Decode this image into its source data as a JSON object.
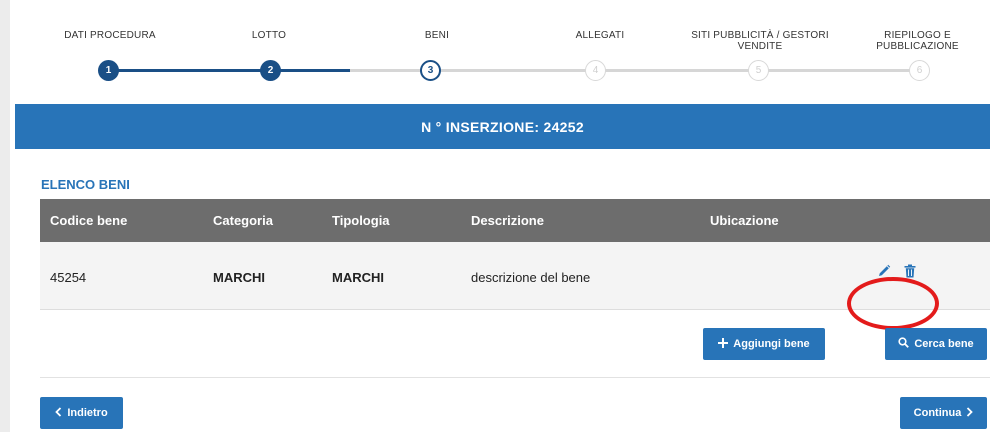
{
  "stepper": {
    "steps": [
      {
        "label_line1": "DATI PROCEDURA",
        "label_line2": "",
        "number": "1",
        "state": "done"
      },
      {
        "label_line1": "LOTTO",
        "label_line2": "",
        "number": "2",
        "state": "done"
      },
      {
        "label_line1": "BENI",
        "label_line2": "",
        "number": "3",
        "state": "active"
      },
      {
        "label_line1": "ALLEGATI",
        "label_line2": "",
        "number": "4",
        "state": "todo"
      },
      {
        "label_line1": "SITI PUBBLICITÀ / GESTORI",
        "label_line2": "VENDITE",
        "number": "5",
        "state": "todo"
      },
      {
        "label_line1": "RIEPILOGO E",
        "label_line2": "PUBBLICAZIONE",
        "number": "6",
        "state": "todo"
      }
    ]
  },
  "banner": {
    "text": "N ° INSERZIONE: 24252"
  },
  "section": {
    "title": "ELENCO BENI"
  },
  "table": {
    "headers": [
      "Codice bene",
      "Categoria",
      "Tipologia",
      "Descrizione",
      "Ubicazione"
    ],
    "rows": [
      {
        "codice": "45254",
        "categoria": "MARCHI",
        "tipologia": "MARCHI",
        "descrizione": "descrizione del bene",
        "ubicazione": ""
      }
    ],
    "row_actions": [
      {
        "icon": "pencil-icon"
      },
      {
        "icon": "trash-icon"
      }
    ]
  },
  "buttons": {
    "add": "Aggiungi bene",
    "search": "Cerca bene",
    "back": "Indietro",
    "continue": "Continua"
  },
  "colors": {
    "primary": "#2874b8",
    "stepper_done": "#1a4f86",
    "table_header": "#6d6d6d",
    "highlight": "#e31b1b"
  }
}
